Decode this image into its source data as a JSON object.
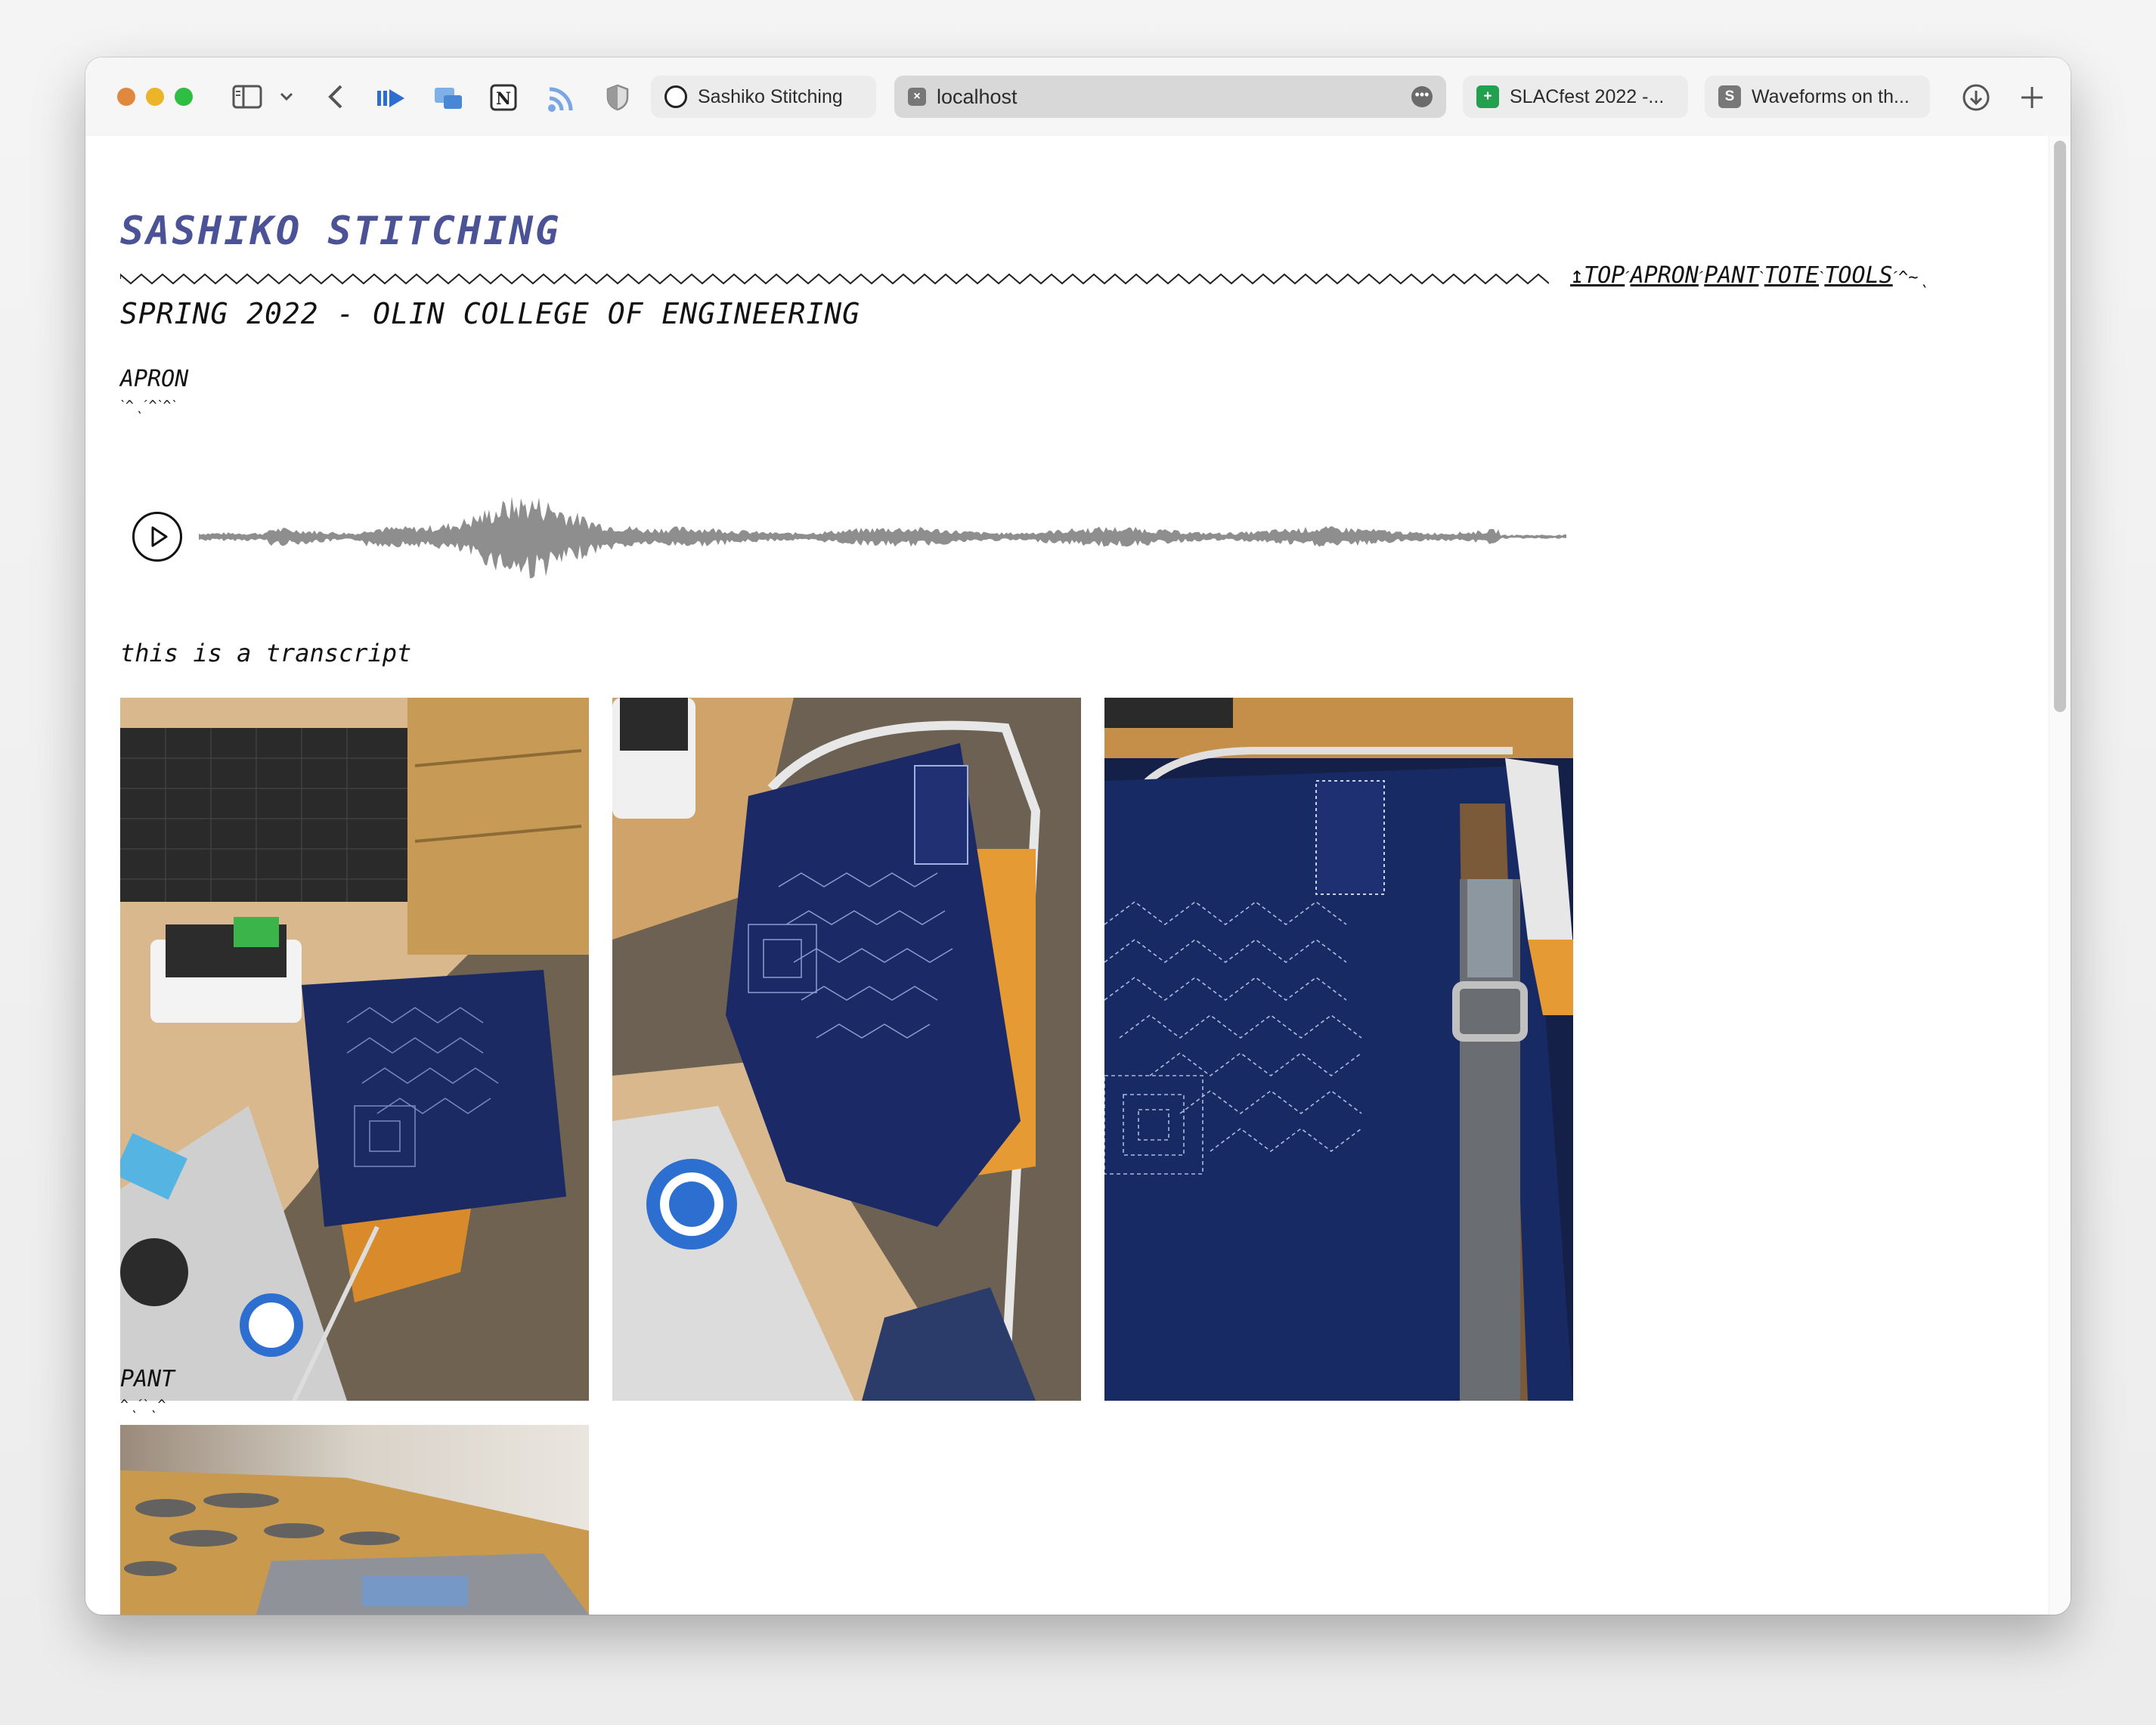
{
  "browser": {
    "tabs": [
      {
        "title": "Sashiko Stitching",
        "favicon": "sashiko-favicon"
      },
      {
        "title": "localhost",
        "favicon": "localhost-favicon",
        "active": true
      },
      {
        "title": "SLACfest 2022 -...",
        "favicon": "sheets-favicon",
        "favicon_letter": "+"
      },
      {
        "title": "Waveforms on th...",
        "favicon": "s-favicon",
        "favicon_letter": "S"
      }
    ],
    "icons": [
      "sidebar-icon",
      "chevron-down-icon",
      "back-icon",
      "extension-icon",
      "pip-icon",
      "notion-icon",
      "rss-icon",
      "shield-icon",
      "download-icon",
      "new-tab-icon",
      "more-icon"
    ]
  },
  "page": {
    "title": "SASHIKO STITCHING",
    "subtitle": "SPRING 2022 - OLIN COLLEGE OF ENGINEERING",
    "nav": {
      "top": "↥TOP",
      "apron": "APRON",
      "pant": "PANT",
      "tote": "TOTE",
      "tools": "TOOLS",
      "sep1": "ˊ",
      "sep2": "ˊ",
      "sep3": "ˋ",
      "sep4": "ˋ",
      "trail": "ˊ^~ˎ"
    },
    "sections": {
      "apron": {
        "heading": "APRON",
        "underline": "ˋ^ˎˊ^ˋ^ˋ",
        "transcript": "this is a transcript"
      },
      "pant": {
        "heading": "PANT",
        "underline": "^ˎˊˋˎ^"
      }
    }
  },
  "colors": {
    "title": "#4c5296",
    "waveform": "#8e8e8e",
    "traffic_red": "#e6894a",
    "traffic_yellow": "#e9b838",
    "traffic_green": "#2ec043",
    "accent_blue": "#2d6fd1"
  }
}
